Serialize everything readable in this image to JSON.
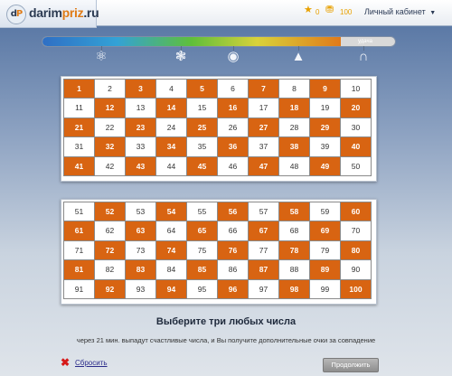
{
  "header": {
    "logo_mark_d": "d",
    "logo_mark_p": "P",
    "logo_text_main": "darim",
    "logo_text_accent": "priz",
    "logo_text_tld": ".ru",
    "stars_count": "0",
    "coins_count": "100",
    "cabinet_label": "Личный кабинет",
    "icons": [
      "star-icon",
      "coins-icon",
      "chevron-down-icon"
    ]
  },
  "progress": {
    "fill_fraction": 0.845,
    "label": "удача"
  },
  "categories": [
    {
      "name": "molecule-icon",
      "glyph": "⚛"
    },
    {
      "name": "brain-icon",
      "glyph": "❃"
    },
    {
      "name": "eye-icon",
      "glyph": "◉"
    },
    {
      "name": "graduation-cap-icon",
      "glyph": "▲"
    },
    {
      "name": "horseshoe-icon",
      "glyph": "∩"
    }
  ],
  "grid_top": {
    "numbers": [
      1,
      2,
      3,
      4,
      5,
      6,
      7,
      8,
      9,
      10,
      11,
      12,
      13,
      14,
      15,
      16,
      17,
      18,
      19,
      20,
      21,
      22,
      23,
      24,
      25,
      26,
      27,
      28,
      29,
      30,
      31,
      32,
      33,
      34,
      35,
      36,
      37,
      38,
      39,
      40,
      41,
      42,
      43,
      44,
      45,
      46,
      47,
      48,
      49,
      50
    ],
    "highlighted": [
      1,
      3,
      5,
      7,
      9,
      12,
      14,
      16,
      18,
      20,
      21,
      23,
      25,
      27,
      29,
      32,
      34,
      36,
      38,
      40,
      41,
      43,
      45,
      47,
      49
    ]
  },
  "grid_bottom": {
    "numbers": [
      51,
      52,
      53,
      54,
      55,
      56,
      57,
      58,
      59,
      60,
      61,
      62,
      63,
      64,
      65,
      66,
      67,
      68,
      69,
      70,
      71,
      72,
      73,
      74,
      75,
      76,
      77,
      78,
      79,
      80,
      81,
      82,
      83,
      84,
      85,
      86,
      87,
      88,
      89,
      90,
      91,
      92,
      93,
      94,
      95,
      96,
      97,
      98,
      99,
      100
    ],
    "highlighted": [
      52,
      54,
      56,
      58,
      60,
      61,
      63,
      65,
      67,
      69,
      72,
      74,
      76,
      78,
      80,
      81,
      83,
      85,
      87,
      89,
      92,
      94,
      96,
      98,
      100
    ]
  },
  "prompt": "Выберите три любых числа",
  "info": "через 21 мин. выпадут счастливые числа, и Вы получите дополнительные очки за совпадение",
  "reset_label": "Сбросить",
  "continue_label": "Продолжить",
  "colors": {
    "accent": "#d86412",
    "brand": "#e07b16",
    "link": "#2a2a8a"
  }
}
